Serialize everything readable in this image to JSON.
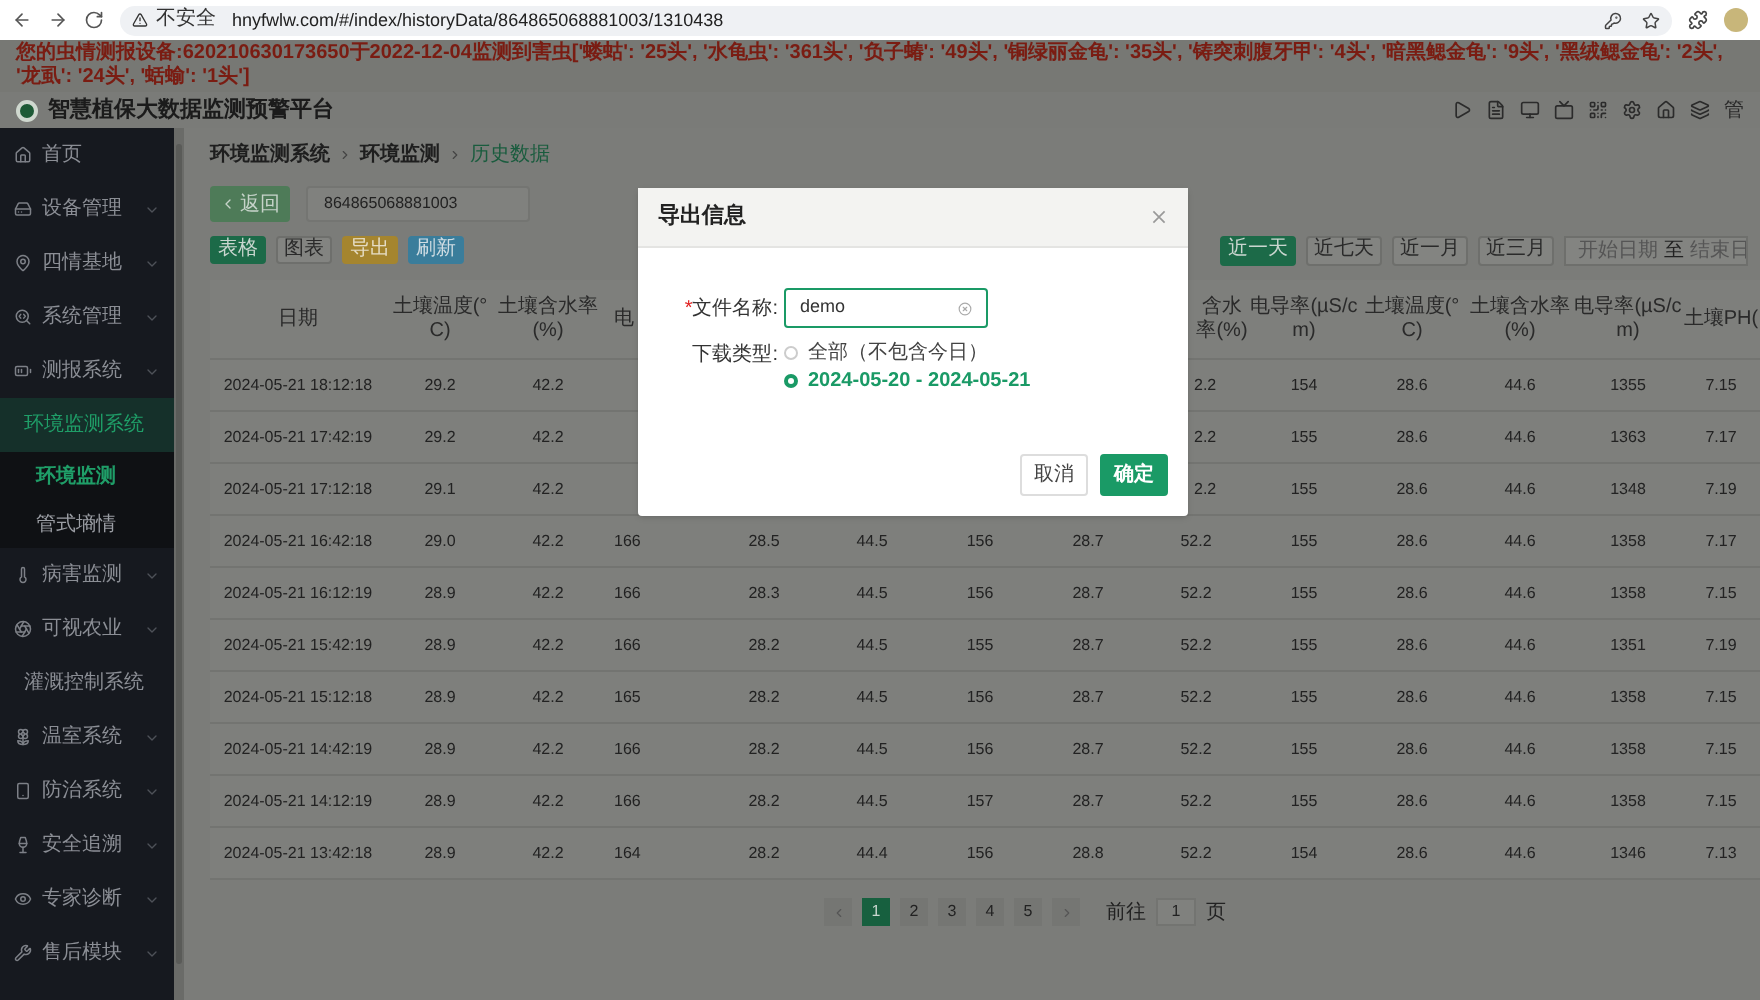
{
  "browser": {
    "security": "不安全",
    "url": "hnyfwlw.com/#/index/historyData/864865068881003/1310438"
  },
  "notice": "您的虫情测报设备:620210630173650于2022-12-04监测到害虫['蝼蛄': '25头', '水龟虫': '361头', '负子蝽': '49头', '铜绿丽金龟': '35头', '铸突刺腹牙甲': '4头', '暗黑鳃金龟': '9头', '黑绒鳃金龟': '2头', '龙虱': '24头', '蛞蝓': '1头']",
  "header": {
    "title": "智慧植保大数据监测预警平台",
    "trailing": "管"
  },
  "sidebar": {
    "items": [
      {
        "label": "首页",
        "kind": "link"
      },
      {
        "label": "设备管理",
        "kind": "group",
        "expanded": false
      },
      {
        "label": "四情基地",
        "kind": "group",
        "expanded": false
      },
      {
        "label": "系统管理",
        "kind": "group",
        "expanded": false
      },
      {
        "label": "测报系统",
        "kind": "group",
        "expanded": false
      },
      {
        "label": "环境监测系统",
        "kind": "group",
        "expanded": true,
        "children": [
          {
            "label": "环境监测",
            "selected": true
          },
          {
            "label": "管式墒情",
            "selected": false
          }
        ]
      },
      {
        "label": "病害监测",
        "kind": "group",
        "expanded": false
      },
      {
        "label": "可视农业",
        "kind": "group",
        "expanded": false
      },
      {
        "label": "灌溉控制系统",
        "kind": "group",
        "expanded": false
      },
      {
        "label": "温室系统",
        "kind": "group",
        "expanded": false
      },
      {
        "label": "防治系统",
        "kind": "group",
        "expanded": false
      },
      {
        "label": "安全追溯",
        "kind": "group",
        "expanded": false
      },
      {
        "label": "专家诊断",
        "kind": "group",
        "expanded": false
      },
      {
        "label": "售后模块",
        "kind": "group",
        "expanded": false
      }
    ]
  },
  "breadcrumb": [
    {
      "label": "环境监测系统",
      "current": false
    },
    {
      "label": "环境监测",
      "current": false
    },
    {
      "label": "历史数据",
      "current": true
    }
  ],
  "toolbar": {
    "back": "返回",
    "device_id": "864865068881003",
    "view_buttons": [
      {
        "label": "表格",
        "kind": "primary"
      },
      {
        "label": "图表",
        "kind": "default"
      },
      {
        "label": "导出",
        "kind": "warning"
      },
      {
        "label": "刷新",
        "kind": "info"
      }
    ],
    "range_buttons": [
      {
        "label": "近一天",
        "selected": true
      },
      {
        "label": "近七天",
        "selected": false
      },
      {
        "label": "近一月",
        "selected": false
      },
      {
        "label": "近三月",
        "selected": false
      }
    ],
    "date_range": {
      "start_placeholder": "开始日期",
      "separator": "至",
      "end_placeholder": "结束日"
    }
  },
  "table": {
    "columns": [
      "日期",
      "土壤温度(°C)",
      "土壤含水率(%)",
      "电",
      null,
      null,
      null,
      null,
      "含水率(%)",
      "电导率(µS/cm)",
      "土壤温度(°C)",
      "土壤含水率(%)",
      "电导率(µS/cm)",
      "土壤PH("
    ],
    "rows": [
      [
        "2024-05-21 18:12:18",
        "29.2",
        "42.2",
        null,
        null,
        null,
        null,
        null,
        "2.2",
        "154",
        "28.6",
        "44.6",
        "1355",
        "7.15"
      ],
      [
        "2024-05-21 17:42:19",
        "29.2",
        "42.2",
        null,
        null,
        null,
        null,
        null,
        "2.2",
        "155",
        "28.6",
        "44.6",
        "1363",
        "7.17"
      ],
      [
        "2024-05-21 17:12:18",
        "29.1",
        "42.2",
        null,
        null,
        null,
        null,
        null,
        "2.2",
        "155",
        "28.6",
        "44.6",
        "1348",
        "7.19"
      ],
      [
        "2024-05-21 16:42:18",
        "29.0",
        "42.2",
        "166",
        "28.5",
        "44.5",
        "156",
        "28.7",
        "52.2",
        "155",
        "28.6",
        "44.6",
        "1358",
        "7.17"
      ],
      [
        "2024-05-21 16:12:19",
        "28.9",
        "42.2",
        "166",
        "28.3",
        "44.5",
        "156",
        "28.7",
        "52.2",
        "155",
        "28.6",
        "44.6",
        "1358",
        "7.15"
      ],
      [
        "2024-05-21 15:42:19",
        "28.9",
        "42.2",
        "166",
        "28.2",
        "44.5",
        "155",
        "28.7",
        "52.2",
        "155",
        "28.6",
        "44.6",
        "1351",
        "7.19"
      ],
      [
        "2024-05-21 15:12:18",
        "28.9",
        "42.2",
        "165",
        "28.2",
        "44.5",
        "156",
        "28.7",
        "52.2",
        "155",
        "28.6",
        "44.6",
        "1358",
        "7.15"
      ],
      [
        "2024-05-21 14:42:19",
        "28.9",
        "42.2",
        "166",
        "28.2",
        "44.5",
        "156",
        "28.7",
        "52.2",
        "155",
        "28.6",
        "44.6",
        "1358",
        "7.15"
      ],
      [
        "2024-05-21 14:12:19",
        "28.9",
        "42.2",
        "166",
        "28.2",
        "44.5",
        "157",
        "28.7",
        "52.2",
        "155",
        "28.6",
        "44.6",
        "1358",
        "7.15"
      ],
      [
        "2024-05-21 13:42:18",
        "28.9",
        "42.2",
        "164",
        "28.2",
        "44.4",
        "156",
        "28.8",
        "52.2",
        "154",
        "28.6",
        "44.6",
        "1346",
        "7.13"
      ]
    ]
  },
  "pagination": {
    "pages": [
      {
        "label": "1",
        "selected": true
      },
      {
        "label": "2",
        "selected": false
      },
      {
        "label": "3",
        "selected": false
      },
      {
        "label": "4",
        "selected": false
      },
      {
        "label": "5",
        "selected": false
      }
    ],
    "goto_label": "前往",
    "goto_value": "1",
    "page_suffix": "页"
  },
  "dialog": {
    "title": "导出信息",
    "file_name": {
      "required_mark": "*",
      "label": "文件名称:",
      "value": "demo"
    },
    "download_type": {
      "label": "下载类型:",
      "options": [
        {
          "label": "全部（不包含今日）",
          "selected": false
        },
        {
          "label": "2024-05-20 - 2024-05-21",
          "selected": true
        }
      ]
    },
    "buttons": [
      {
        "label": "取消",
        "kind": "default"
      },
      {
        "label": "确定",
        "kind": "primary"
      }
    ]
  }
}
